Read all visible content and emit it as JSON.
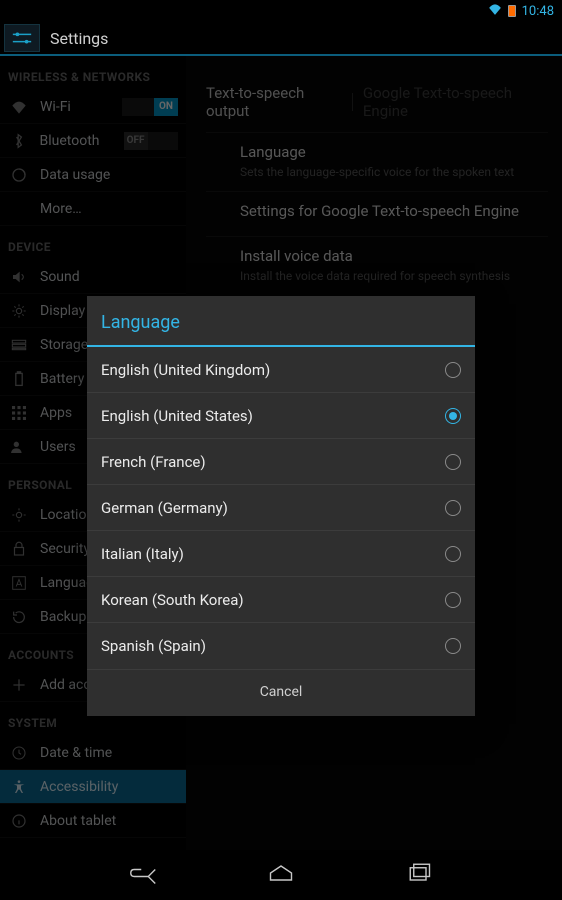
{
  "status": {
    "time": "10:48"
  },
  "app": {
    "title": "Settings"
  },
  "sidebar": {
    "sections": {
      "wireless": {
        "header": "WIRELESS & NETWORKS",
        "wifi": {
          "label": "Wi-Fi",
          "toggle": "ON",
          "on": true
        },
        "bluetooth": {
          "label": "Bluetooth",
          "toggle": "OFF",
          "on": false
        },
        "data_usage": {
          "label": "Data usage"
        },
        "more": {
          "label": "More…"
        }
      },
      "device": {
        "header": "DEVICE",
        "sound": {
          "label": "Sound"
        },
        "display": {
          "label": "Display"
        },
        "storage": {
          "label": "Storage"
        },
        "battery": {
          "label": "Battery"
        },
        "apps": {
          "label": "Apps"
        },
        "users": {
          "label": "Users"
        }
      },
      "personal": {
        "header": "PERSONAL",
        "location": {
          "label": "Location access"
        },
        "security": {
          "label": "Security"
        },
        "language": {
          "label": "Language & input"
        },
        "backup": {
          "label": "Backup & reset"
        }
      },
      "accounts": {
        "header": "ACCOUNTS",
        "add": {
          "label": "Add account"
        }
      },
      "system": {
        "header": "SYSTEM",
        "date_time": {
          "label": "Date & time"
        },
        "accessibility": {
          "label": "Accessibility"
        },
        "about": {
          "label": "About tablet"
        }
      }
    }
  },
  "main": {
    "crumb_current": "Text-to-speech output",
    "crumb_next": "Google Text-to-speech Engine",
    "items": {
      "language": {
        "title": "Language",
        "sub": "Sets the language-specific voice for the spoken text"
      },
      "engine_set": {
        "title": "Settings for Google Text-to-speech Engine"
      },
      "install": {
        "title": "Install voice data",
        "sub": "Install the voice data required for speech synthesis"
      }
    }
  },
  "dialog": {
    "title": "Language",
    "options": [
      {
        "label": "English (United Kingdom)"
      },
      {
        "label": "English (United States)",
        "selected": true
      },
      {
        "label": "French (France)"
      },
      {
        "label": "German (Germany)"
      },
      {
        "label": "Italian (Italy)"
      },
      {
        "label": "Korean (South Korea)"
      },
      {
        "label": "Spanish (Spain)"
      }
    ],
    "cancel": "Cancel"
  }
}
